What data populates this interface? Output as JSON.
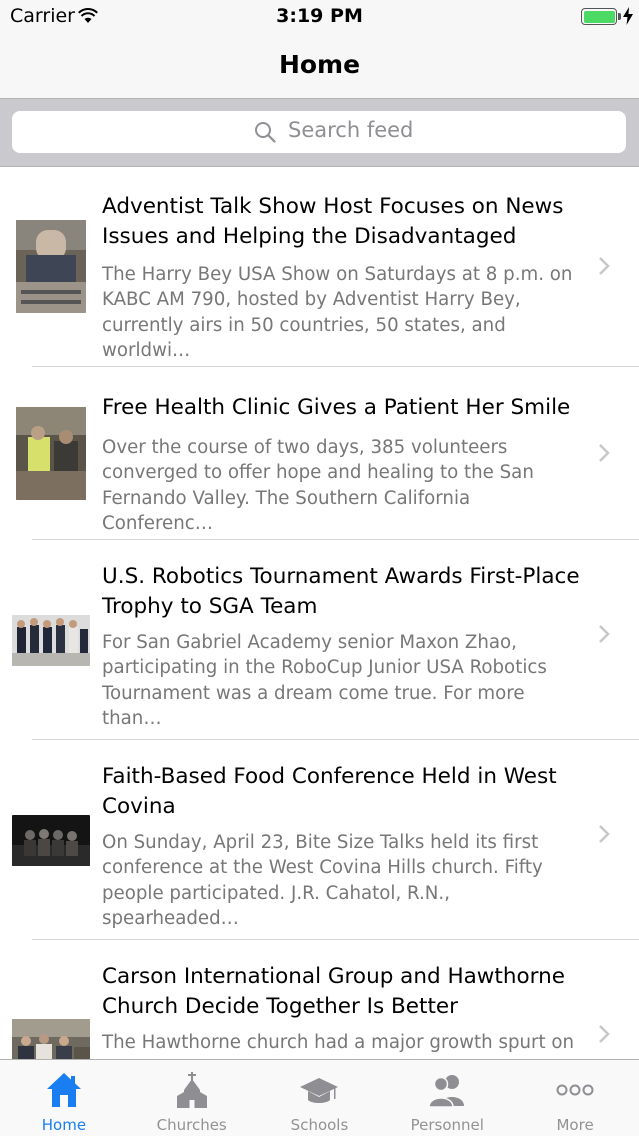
{
  "status_bar": {
    "carrier": "Carrier",
    "time": "3:19 PM",
    "battery_color": "#4cd964"
  },
  "nav": {
    "title": "Home"
  },
  "search": {
    "placeholder": "Search feed"
  },
  "feed": [
    {
      "title": "Adventist Talk Show Host Focuses on News Issues and Helping the Disadvantaged",
      "excerpt": "The Harry Bey USA Show on Saturdays at 8 p.m. on KABC AM 790, hosted by Adventist Harry Bey, currently airs in 50 countries, 50 states, and worldwi…"
    },
    {
      "title": "Free Health Clinic Gives a Patient Her Smile",
      "excerpt": "Over the course of two days, 385 volunteers converged to offer hope and healing to the San Fernando Valley. The Southern California Conferenc…"
    },
    {
      "title": "U.S. Robotics Tournament Awards First-Place Trophy to SGA Team",
      "excerpt": "For San Gabriel Academy senior Maxon Zhao, participating in the RoboCup Junior USA Robotics Tournament was a dream come true. For more than…"
    },
    {
      "title": "Faith-Based Food Conference Held in West Covina",
      "excerpt": "On Sunday, April 23, Bite Size Talks held its first conference at the West Covina Hills church. Fifty people participated. J.R. Cahatol, R.N., spearheaded…"
    },
    {
      "title": "Carson International Group and Hawthorne Church Decide Together Is Better",
      "excerpt": "The Hawthorne church had a major growth spurt on"
    }
  ],
  "tabs": [
    {
      "label": "Home",
      "icon": "home-icon",
      "active": true
    },
    {
      "label": "Churches",
      "icon": "church-icon",
      "active": false
    },
    {
      "label": "Schools",
      "icon": "graduation-cap-icon",
      "active": false
    },
    {
      "label": "Personnel",
      "icon": "people-icon",
      "active": false
    },
    {
      "label": "More",
      "icon": "more-dots-icon",
      "active": false
    }
  ],
  "colors": {
    "accent": "#1a7ef3",
    "inactive_tab": "#929292"
  }
}
